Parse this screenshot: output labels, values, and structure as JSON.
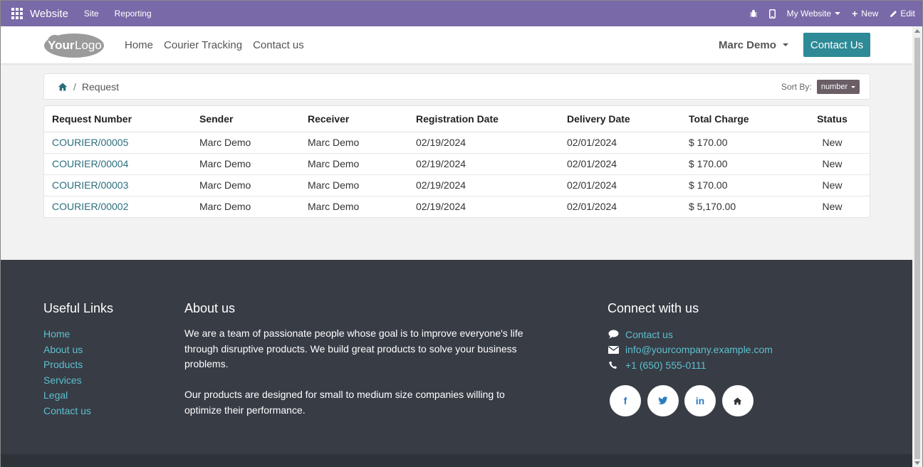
{
  "topbar": {
    "app_name": "Website",
    "menu": [
      "Site",
      "Reporting"
    ],
    "website_selector": "My Website",
    "new_label": "New",
    "edit_label": "Edit"
  },
  "header": {
    "logo_text": "YourLogo",
    "nav": [
      "Home",
      "Courier Tracking",
      "Contact us"
    ],
    "user": "Marc Demo",
    "contact_button": "Contact Us"
  },
  "breadcrumb": {
    "current": "Request",
    "sort_label": "Sort By:",
    "sort_value": "number"
  },
  "table": {
    "columns": [
      "Request Number",
      "Sender",
      "Receiver",
      "Registration Date",
      "Delivery Date",
      "Total Charge",
      "Status"
    ],
    "rows": [
      [
        "COURIER/00005",
        "Marc Demo",
        "Marc Demo",
        "02/19/2024",
        "02/01/2024",
        "$ 170.00",
        "New"
      ],
      [
        "COURIER/00004",
        "Marc Demo",
        "Marc Demo",
        "02/19/2024",
        "02/01/2024",
        "$ 170.00",
        "New"
      ],
      [
        "COURIER/00003",
        "Marc Demo",
        "Marc Demo",
        "02/19/2024",
        "02/01/2024",
        "$ 170.00",
        "New"
      ],
      [
        "COURIER/00002",
        "Marc Demo",
        "Marc Demo",
        "02/19/2024",
        "02/01/2024",
        "$ 5,170.00",
        "New"
      ]
    ]
  },
  "footer": {
    "useful_links_title": "Useful Links",
    "useful_links": [
      "Home",
      "About us",
      "Products",
      "Services",
      "Legal",
      "Contact us"
    ],
    "about_title": "About us",
    "about_p1": "We are a team of passionate people whose goal is to improve everyone's life through disruptive products. We build great products to solve your business problems.",
    "about_p2": "Our products are designed for small to medium size companies willing to optimize their performance.",
    "connect_title": "Connect with us",
    "contact_link": "Contact us",
    "email": "info@yourcompany.example.com",
    "phone": "+1 (650) 555-0111",
    "social_icons": [
      "facebook-icon",
      "twitter-icon",
      "linkedin-icon",
      "home-icon"
    ],
    "social_glyphs": [
      "f",
      "t",
      "in",
      "⌂"
    ]
  },
  "colors": {
    "topbar": "#7a69a8",
    "accent": "#2d8a96",
    "link": "#2b6e7e",
    "footer_bg": "#383c45",
    "footer_link": "#5cc0cf"
  }
}
